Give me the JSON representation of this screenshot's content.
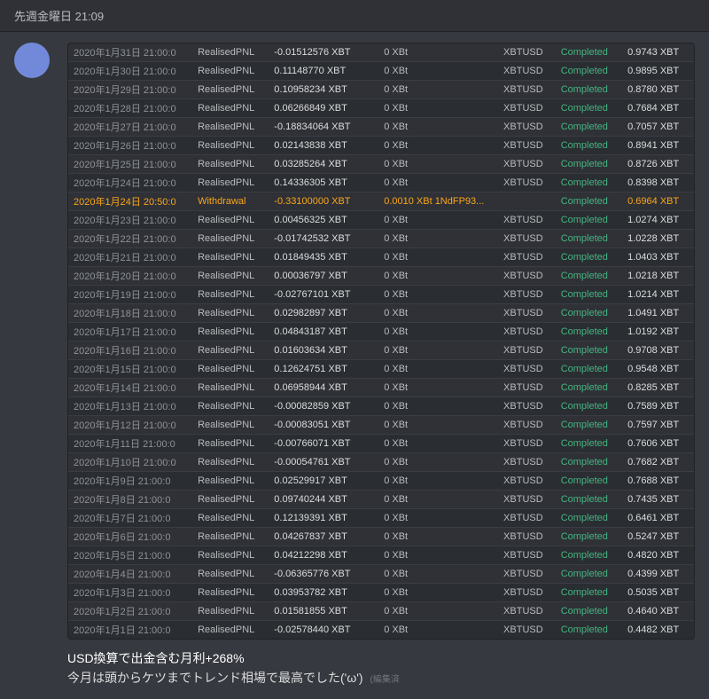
{
  "topbar": {
    "datetime": "先週金曜日 21:09"
  },
  "message": {
    "username": "",
    "timestamp": "先週金曜日 21:09",
    "text_line1": "USD換算で出金含む月利+268%",
    "text_line2": "今月は頭からケツまでトレンド相場で最高でした('ω')",
    "edited_label": "(編集済"
  },
  "table": {
    "rows": [
      {
        "date": "2020年1月31日 21:00:0",
        "type": "RealisedPNL",
        "amount": "-0.01512576 XBT",
        "fee": "0 XBt",
        "asset": "XBTUSD",
        "status": "Completed",
        "balance": "0.9743 XBT"
      },
      {
        "date": "2020年1月30日 21:00:0",
        "type": "RealisedPNL",
        "amount": "0.11148770 XBT",
        "fee": "0 XBt",
        "asset": "XBTUSD",
        "status": "Completed",
        "balance": "0.9895 XBT"
      },
      {
        "date": "2020年1月29日 21:00:0",
        "type": "RealisedPNL",
        "amount": "0.10958234 XBT",
        "fee": "0 XBt",
        "asset": "XBTUSD",
        "status": "Completed",
        "balance": "0.8780 XBT"
      },
      {
        "date": "2020年1月28日 21:00:0",
        "type": "RealisedPNL",
        "amount": "0.06266849 XBT",
        "fee": "0 XBt",
        "asset": "XBTUSD",
        "status": "Completed",
        "balance": "0.7684 XBT"
      },
      {
        "date": "2020年1月27日 21:00:0",
        "type": "RealisedPNL",
        "amount": "-0.18834064 XBT",
        "fee": "0 XBt",
        "asset": "XBTUSD",
        "status": "Completed",
        "balance": "0.7057 XBT"
      },
      {
        "date": "2020年1月26日 21:00:0",
        "type": "RealisedPNL",
        "amount": "0.02143838 XBT",
        "fee": "0 XBt",
        "asset": "XBTUSD",
        "status": "Completed",
        "balance": "0.8941 XBT"
      },
      {
        "date": "2020年1月25日 21:00:0",
        "type": "RealisedPNL",
        "amount": "0.03285264 XBT",
        "fee": "0 XBt",
        "asset": "XBTUSD",
        "status": "Completed",
        "balance": "0.8726 XBT"
      },
      {
        "date": "2020年1月24日 21:00:0",
        "type": "RealisedPNL",
        "amount": "0.14336305 XBT",
        "fee": "0 XBt",
        "asset": "XBTUSD",
        "status": "Completed",
        "balance": "0.8398 XBT"
      },
      {
        "date": "2020年1月24日 20:50:0",
        "type": "Withdrawal",
        "amount": "-0.33100000 XBT",
        "fee": "0.0010 XBt",
        "fee2": "1NdFP93...",
        "asset": "",
        "status": "Completed",
        "balance": "0.6964 XBT",
        "isWithdrawal": true
      },
      {
        "date": "2020年1月23日 21:00:0",
        "type": "RealisedPNL",
        "amount": "0.00456325 XBT",
        "fee": "0 XBt",
        "asset": "XBTUSD",
        "status": "Completed",
        "balance": "1.0274 XBT"
      },
      {
        "date": "2020年1月22日 21:00:0",
        "type": "RealisedPNL",
        "amount": "-0.01742532 XBT",
        "fee": "0 XBt",
        "asset": "XBTUSD",
        "status": "Completed",
        "balance": "1.0228 XBT"
      },
      {
        "date": "2020年1月21日 21:00:0",
        "type": "RealisedPNL",
        "amount": "0.01849435 XBT",
        "fee": "0 XBt",
        "asset": "XBTUSD",
        "status": "Completed",
        "balance": "1.0403 XBT"
      },
      {
        "date": "2020年1月20日 21:00:0",
        "type": "RealisedPNL",
        "amount": "0.00036797 XBT",
        "fee": "0 XBt",
        "asset": "XBTUSD",
        "status": "Completed",
        "balance": "1.0218 XBT"
      },
      {
        "date": "2020年1月19日 21:00:0",
        "type": "RealisedPNL",
        "amount": "-0.02767101 XBT",
        "fee": "0 XBt",
        "asset": "XBTUSD",
        "status": "Completed",
        "balance": "1.0214 XBT"
      },
      {
        "date": "2020年1月18日 21:00:0",
        "type": "RealisedPNL",
        "amount": "0.02982897 XBT",
        "fee": "0 XBt",
        "asset": "XBTUSD",
        "status": "Completed",
        "balance": "1.0491 XBT"
      },
      {
        "date": "2020年1月17日 21:00:0",
        "type": "RealisedPNL",
        "amount": "0.04843187 XBT",
        "fee": "0 XBt",
        "asset": "XBTUSD",
        "status": "Completed",
        "balance": "1.0192 XBT"
      },
      {
        "date": "2020年1月16日 21:00:0",
        "type": "RealisedPNL",
        "amount": "0.01603634 XBT",
        "fee": "0 XBt",
        "asset": "XBTUSD",
        "status": "Completed",
        "balance": "0.9708 XBT"
      },
      {
        "date": "2020年1月15日 21:00:0",
        "type": "RealisedPNL",
        "amount": "0.12624751 XBT",
        "fee": "0 XBt",
        "asset": "XBTUSD",
        "status": "Completed",
        "balance": "0.9548 XBT"
      },
      {
        "date": "2020年1月14日 21:00:0",
        "type": "RealisedPNL",
        "amount": "0.06958944 XBT",
        "fee": "0 XBt",
        "asset": "XBTUSD",
        "status": "Completed",
        "balance": "0.8285 XBT"
      },
      {
        "date": "2020年1月13日 21:00:0",
        "type": "RealisedPNL",
        "amount": "-0.00082859 XBT",
        "fee": "0 XBt",
        "asset": "XBTUSD",
        "status": "Completed",
        "balance": "0.7589 XBT"
      },
      {
        "date": "2020年1月12日 21:00:0",
        "type": "RealisedPNL",
        "amount": "-0.00083051 XBT",
        "fee": "0 XBt",
        "asset": "XBTUSD",
        "status": "Completed",
        "balance": "0.7597 XBT"
      },
      {
        "date": "2020年1月11日 21:00:0",
        "type": "RealisedPNL",
        "amount": "-0.00766071 XBT",
        "fee": "0 XBt",
        "asset": "XBTUSD",
        "status": "Completed",
        "balance": "0.7606 XBT"
      },
      {
        "date": "2020年1月10日 21:00:0",
        "type": "RealisedPNL",
        "amount": "-0.00054761 XBT",
        "fee": "0 XBt",
        "asset": "XBTUSD",
        "status": "Completed",
        "balance": "0.7682 XBT"
      },
      {
        "date": "2020年1月9日 21:00:0",
        "type": "RealisedPNL",
        "amount": "0.02529917 XBT",
        "fee": "0 XBt",
        "asset": "XBTUSD",
        "status": "Completed",
        "balance": "0.7688 XBT"
      },
      {
        "date": "2020年1月8日 21:00:0",
        "type": "RealisedPNL",
        "amount": "0.09740244 XBT",
        "fee": "0 XBt",
        "asset": "XBTUSD",
        "status": "Completed",
        "balance": "0.7435 XBT"
      },
      {
        "date": "2020年1月7日 21:00:0",
        "type": "RealisedPNL",
        "amount": "0.12139391 XBT",
        "fee": "0 XBt",
        "asset": "XBTUSD",
        "status": "Completed",
        "balance": "0.6461 XBT"
      },
      {
        "date": "2020年1月6日 21:00:0",
        "type": "RealisedPNL",
        "amount": "0.04267837 XBT",
        "fee": "0 XBt",
        "asset": "XBTUSD",
        "status": "Completed",
        "balance": "0.5247 XBT"
      },
      {
        "date": "2020年1月5日 21:00:0",
        "type": "RealisedPNL",
        "amount": "0.04212298 XBT",
        "fee": "0 XBt",
        "asset": "XBTUSD",
        "status": "Completed",
        "balance": "0.4820 XBT"
      },
      {
        "date": "2020年1月4日 21:00:0",
        "type": "RealisedPNL",
        "amount": "-0.06365776 XBT",
        "fee": "0 XBt",
        "asset": "XBTUSD",
        "status": "Completed",
        "balance": "0.4399 XBT"
      },
      {
        "date": "2020年1月3日 21:00:0",
        "type": "RealisedPNL",
        "amount": "0.03953782 XBT",
        "fee": "0 XBt",
        "asset": "XBTUSD",
        "status": "Completed",
        "balance": "0.5035 XBT"
      },
      {
        "date": "2020年1月2日 21:00:0",
        "type": "RealisedPNL",
        "amount": "0.01581855 XBT",
        "fee": "0 XBt",
        "asset": "XBTUSD",
        "status": "Completed",
        "balance": "0.4640 XBT"
      },
      {
        "date": "2020年1月1日 21:00:0",
        "type": "RealisedPNL",
        "amount": "-0.02578440 XBT",
        "fee": "0 XBt",
        "asset": "XBTUSD",
        "status": "Completed",
        "balance": "0.4482 XBT"
      }
    ]
  }
}
